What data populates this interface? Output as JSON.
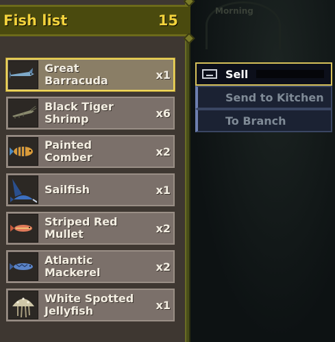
{
  "background": {
    "time_of_day": "Morning"
  },
  "fish_list": {
    "title": "Fish list",
    "count": "15",
    "items": [
      {
        "name": "Great\nBarracuda",
        "qty": "x1",
        "icon": "barracuda-icon",
        "color": "#7ea9c9"
      },
      {
        "name": "Black Tiger\nShrimp",
        "qty": "x6",
        "icon": "shrimp-icon",
        "color": "#8a8a6e"
      },
      {
        "name": "Painted\nComber",
        "qty": "x2",
        "icon": "comber-icon",
        "color": "#d89a3a"
      },
      {
        "name": "Sailfish",
        "qty": "x1",
        "icon": "sailfish-icon",
        "color": "#3c6fc0"
      },
      {
        "name": "Striped Red\nMullet",
        "qty": "x2",
        "icon": "mullet-icon",
        "color": "#e07a5a"
      },
      {
        "name": "Atlantic\nMackerel",
        "qty": "x2",
        "icon": "mackerel-icon",
        "color": "#5b84c8"
      },
      {
        "name": "White Spotted\nJellyfish",
        "qty": "x1",
        "icon": "jellyfish-icon",
        "color": "#cfc7a8"
      }
    ]
  },
  "action_menu": {
    "sell": "Sell",
    "send_to_kitchen": "Send to Kitchen",
    "to_branch": "To Branch"
  }
}
